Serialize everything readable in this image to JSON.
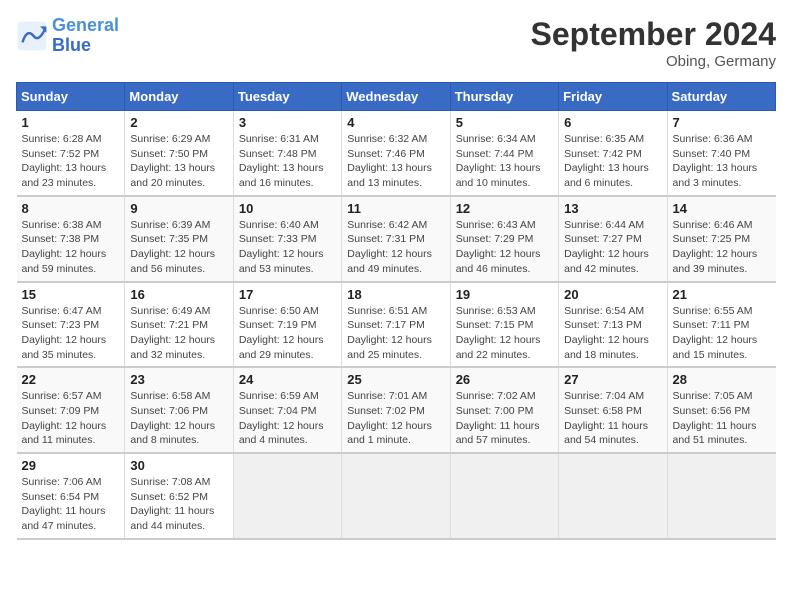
{
  "header": {
    "logo_general": "General",
    "logo_blue": "Blue",
    "month_title": "September 2024",
    "location": "Obing, Germany"
  },
  "weekdays": [
    "Sunday",
    "Monday",
    "Tuesday",
    "Wednesday",
    "Thursday",
    "Friday",
    "Saturday"
  ],
  "weeks": [
    [
      {
        "day": "1",
        "sunrise": "6:28 AM",
        "sunset": "7:52 PM",
        "daylight": "13 hours and 23 minutes."
      },
      {
        "day": "2",
        "sunrise": "6:29 AM",
        "sunset": "7:50 PM",
        "daylight": "13 hours and 20 minutes."
      },
      {
        "day": "3",
        "sunrise": "6:31 AM",
        "sunset": "7:48 PM",
        "daylight": "13 hours and 16 minutes."
      },
      {
        "day": "4",
        "sunrise": "6:32 AM",
        "sunset": "7:46 PM",
        "daylight": "13 hours and 13 minutes."
      },
      {
        "day": "5",
        "sunrise": "6:34 AM",
        "sunset": "7:44 PM",
        "daylight": "13 hours and 10 minutes."
      },
      {
        "day": "6",
        "sunrise": "6:35 AM",
        "sunset": "7:42 PM",
        "daylight": "13 hours and 6 minutes."
      },
      {
        "day": "7",
        "sunrise": "6:36 AM",
        "sunset": "7:40 PM",
        "daylight": "13 hours and 3 minutes."
      }
    ],
    [
      {
        "day": "8",
        "sunrise": "6:38 AM",
        "sunset": "7:38 PM",
        "daylight": "12 hours and 59 minutes."
      },
      {
        "day": "9",
        "sunrise": "6:39 AM",
        "sunset": "7:35 PM",
        "daylight": "12 hours and 56 minutes."
      },
      {
        "day": "10",
        "sunrise": "6:40 AM",
        "sunset": "7:33 PM",
        "daylight": "12 hours and 53 minutes."
      },
      {
        "day": "11",
        "sunrise": "6:42 AM",
        "sunset": "7:31 PM",
        "daylight": "12 hours and 49 minutes."
      },
      {
        "day": "12",
        "sunrise": "6:43 AM",
        "sunset": "7:29 PM",
        "daylight": "12 hours and 46 minutes."
      },
      {
        "day": "13",
        "sunrise": "6:44 AM",
        "sunset": "7:27 PM",
        "daylight": "12 hours and 42 minutes."
      },
      {
        "day": "14",
        "sunrise": "6:46 AM",
        "sunset": "7:25 PM",
        "daylight": "12 hours and 39 minutes."
      }
    ],
    [
      {
        "day": "15",
        "sunrise": "6:47 AM",
        "sunset": "7:23 PM",
        "daylight": "12 hours and 35 minutes."
      },
      {
        "day": "16",
        "sunrise": "6:49 AM",
        "sunset": "7:21 PM",
        "daylight": "12 hours and 32 minutes."
      },
      {
        "day": "17",
        "sunrise": "6:50 AM",
        "sunset": "7:19 PM",
        "daylight": "12 hours and 29 minutes."
      },
      {
        "day": "18",
        "sunrise": "6:51 AM",
        "sunset": "7:17 PM",
        "daylight": "12 hours and 25 minutes."
      },
      {
        "day": "19",
        "sunrise": "6:53 AM",
        "sunset": "7:15 PM",
        "daylight": "12 hours and 22 minutes."
      },
      {
        "day": "20",
        "sunrise": "6:54 AM",
        "sunset": "7:13 PM",
        "daylight": "12 hours and 18 minutes."
      },
      {
        "day": "21",
        "sunrise": "6:55 AM",
        "sunset": "7:11 PM",
        "daylight": "12 hours and 15 minutes."
      }
    ],
    [
      {
        "day": "22",
        "sunrise": "6:57 AM",
        "sunset": "7:09 PM",
        "daylight": "12 hours and 11 minutes."
      },
      {
        "day": "23",
        "sunrise": "6:58 AM",
        "sunset": "7:06 PM",
        "daylight": "12 hours and 8 minutes."
      },
      {
        "day": "24",
        "sunrise": "6:59 AM",
        "sunset": "7:04 PM",
        "daylight": "12 hours and 4 minutes."
      },
      {
        "day": "25",
        "sunrise": "7:01 AM",
        "sunset": "7:02 PM",
        "daylight": "12 hours and 1 minute."
      },
      {
        "day": "26",
        "sunrise": "7:02 AM",
        "sunset": "7:00 PM",
        "daylight": "11 hours and 57 minutes."
      },
      {
        "day": "27",
        "sunrise": "7:04 AM",
        "sunset": "6:58 PM",
        "daylight": "11 hours and 54 minutes."
      },
      {
        "day": "28",
        "sunrise": "7:05 AM",
        "sunset": "6:56 PM",
        "daylight": "11 hours and 51 minutes."
      }
    ],
    [
      {
        "day": "29",
        "sunrise": "7:06 AM",
        "sunset": "6:54 PM",
        "daylight": "11 hours and 47 minutes."
      },
      {
        "day": "30",
        "sunrise": "7:08 AM",
        "sunset": "6:52 PM",
        "daylight": "11 hours and 44 minutes."
      },
      null,
      null,
      null,
      null,
      null
    ]
  ]
}
